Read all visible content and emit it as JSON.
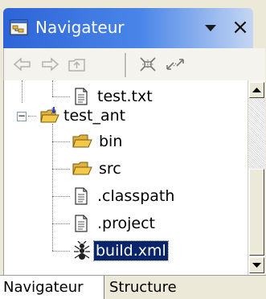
{
  "view": {
    "title": "Navigateur",
    "close_glyph": "×",
    "icons": {
      "title": "navigator-view-icon",
      "menu": "view-menu-triangle-icon",
      "close": "close-icon"
    }
  },
  "toolbar": {
    "buttons": [
      {
        "name": "back-arrow-icon",
        "enabled": false
      },
      {
        "name": "forward-arrow-icon",
        "enabled": false
      },
      {
        "name": "up-folder-icon",
        "enabled": false
      },
      {
        "name": "collapse-all-icon",
        "enabled": true
      },
      {
        "name": "link-with-editor-icon",
        "enabled": true
      }
    ]
  },
  "tree": {
    "rows": [
      {
        "label": "test.txt",
        "icon": "text-file-icon",
        "indent": 1
      },
      {
        "label": "test_ant",
        "icon": "project-folder-icon",
        "indent": 0,
        "expanded": true,
        "expander": "−"
      },
      {
        "label": "bin",
        "icon": "folder-icon",
        "indent": 1
      },
      {
        "label": "src",
        "icon": "folder-icon",
        "indent": 1
      },
      {
        "label": ".classpath",
        "icon": "text-file-icon",
        "indent": 1
      },
      {
        "label": ".project",
        "icon": "text-file-icon",
        "indent": 1
      },
      {
        "label": "build.xml",
        "icon": "ant-file-icon",
        "indent": 1,
        "selected": true
      }
    ]
  },
  "bottom_tabs": [
    {
      "label": "Navigateur",
      "active": true
    },
    {
      "label": "Structure",
      "active": false
    }
  ],
  "colors": {
    "titlebar_start": "#2d64d8",
    "selection_bg": "#0a246a",
    "folder_yellow": "#f3c94a"
  }
}
